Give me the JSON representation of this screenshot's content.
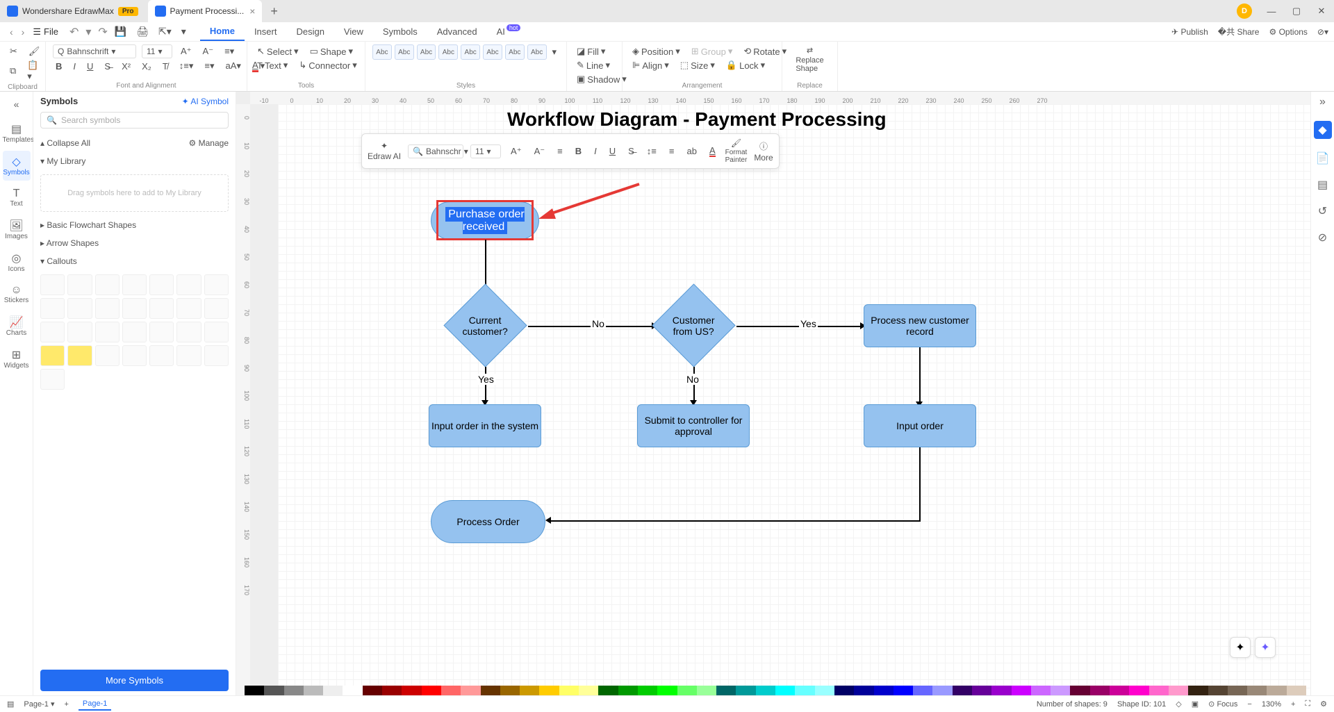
{
  "app": {
    "name": "Wondershare EdrawMax",
    "badge": "Pro",
    "avatar_initial": "D"
  },
  "tabs": {
    "doc": "Payment Processi..."
  },
  "menubar": {
    "file": "File",
    "items": [
      "Home",
      "Insert",
      "Design",
      "View",
      "Symbols",
      "Advanced",
      "AI"
    ],
    "hot": "hot",
    "publish": "Publish",
    "share": "Share",
    "options": "Options"
  },
  "ribbon": {
    "clipboard": "Clipboard",
    "font_alignment": "Font and Alignment",
    "tools": "Tools",
    "styles": "Styles",
    "arrangement": "Arrangement",
    "replace": "Replace",
    "font_name": "Bahnschrift",
    "font_size": "11",
    "select": "Select",
    "shape": "Shape",
    "text": "Text",
    "connector": "Connector",
    "fill": "Fill",
    "line": "Line",
    "shadow": "Shadow",
    "position": "Position",
    "group": "Group",
    "rotate": "Rotate",
    "align": "Align",
    "size": "Size",
    "lock": "Lock",
    "replace_shape": "Replace\nShape",
    "style_label": "Abc"
  },
  "left_rail": [
    "Templates",
    "Symbols",
    "Text",
    "Images",
    "Icons",
    "Stickers",
    "Charts",
    "Widgets"
  ],
  "symbols": {
    "title": "Symbols",
    "ai": "AI Symbol",
    "search_placeholder": "Search symbols",
    "collapse": "Collapse All",
    "manage": "Manage",
    "mylib": "My Library",
    "mylib_hint": "Drag symbols here to add to My Library",
    "basic": "Basic Flowchart Shapes",
    "arrow": "Arrow Shapes",
    "callouts": "Callouts",
    "more": "More Symbols"
  },
  "diagram": {
    "title": "Workflow Diagram - Payment Processing",
    "nodes": {
      "start": "Purchase order received",
      "d1": "Current customer?",
      "d2": "Customer from US?",
      "p1": "Process new customer record",
      "p2": "Input order in the system",
      "p3": "Submit to controller for approval",
      "p4": "Input order",
      "end": "Process Order"
    },
    "labels": {
      "yes": "Yes",
      "no": "No"
    }
  },
  "mini": {
    "edraw_ai": "Edraw AI",
    "font": "Bahnschr",
    "size": "11",
    "format_painter": "Format\nPainter",
    "more": "More"
  },
  "status": {
    "page_sel": "Page-1",
    "page_tab": "Page-1",
    "shapes": "Number of shapes: 9",
    "shape_id": "Shape ID: 101",
    "focus": "Focus",
    "zoom": "130%"
  },
  "ruler_h": [
    "-10",
    "0",
    "10",
    "20",
    "30",
    "40",
    "50",
    "60",
    "70",
    "80",
    "90",
    "100",
    "110",
    "120",
    "130",
    "140",
    "150",
    "160",
    "170",
    "180",
    "190",
    "200",
    "210",
    "220",
    "230",
    "240",
    "250",
    "260",
    "270"
  ],
  "ruler_v": [
    "0",
    "10",
    "20",
    "30",
    "40",
    "50",
    "60",
    "70",
    "80",
    "90",
    "100",
    "110",
    "120",
    "130",
    "140",
    "150",
    "160",
    "170"
  ]
}
